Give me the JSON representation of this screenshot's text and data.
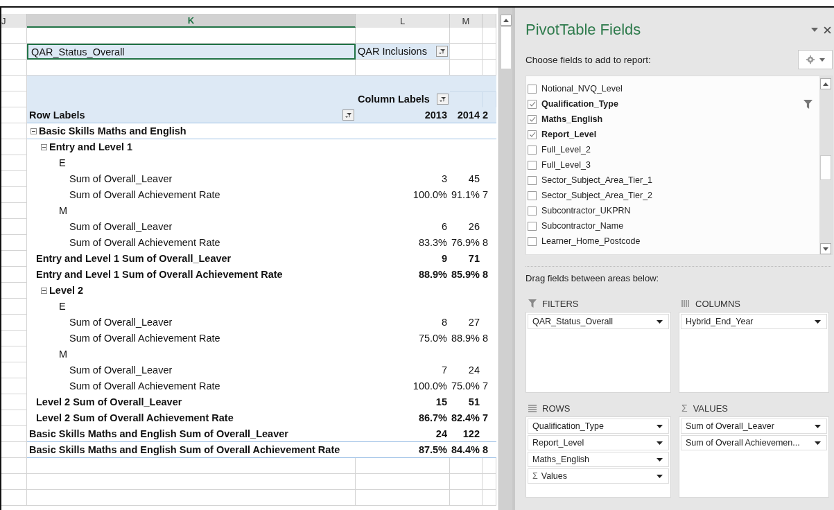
{
  "sheet": {
    "column_headers": [
      {
        "label": "J",
        "selected": false
      },
      {
        "label": "K",
        "selected": true
      },
      {
        "label": "L",
        "selected": false
      },
      {
        "label": "M",
        "selected": false
      }
    ],
    "report_filter": {
      "field": "QAR_Status_Overall",
      "value": "QAR Inclusions"
    },
    "pivot": {
      "column_labels": "Column Labels",
      "row_labels": "Row Labels",
      "years": [
        "2013",
        "2014",
        "2"
      ],
      "rows": [
        {
          "label": "Basic Skills Maths and English",
          "expanded": true,
          "children": [
            {
              "label": "Entry and Level 1",
              "expanded": true,
              "children": [
                {
                  "label": "E",
                  "children": [
                    {
                      "label": "Sum of Overall_Leaver",
                      "values": [
                        "3",
                        "45"
                      ]
                    },
                    {
                      "label": "Sum of Overall Achievement Rate",
                      "values": [
                        "100.0%",
                        "91.1%",
                        "7"
                      ]
                    }
                  ]
                },
                {
                  "label": "M",
                  "children": [
                    {
                      "label": "Sum of Overall_Leaver",
                      "values": [
                        "6",
                        "26"
                      ]
                    },
                    {
                      "label": "Sum of Overall Achievement Rate",
                      "values": [
                        "83.3%",
                        "76.9%",
                        "8"
                      ]
                    }
                  ]
                }
              ],
              "totals": [
                {
                  "label": "Entry and Level 1 Sum of Overall_Leaver",
                  "values": [
                    "9",
                    "71"
                  ]
                },
                {
                  "label": "Entry and Level 1 Sum of Overall Achievement Rate",
                  "values": [
                    "88.9%",
                    "85.9%",
                    "8"
                  ]
                }
              ]
            },
            {
              "label": "Level 2",
              "expanded": true,
              "children": [
                {
                  "label": "E",
                  "children": [
                    {
                      "label": "Sum of Overall_Leaver",
                      "values": [
                        "8",
                        "27"
                      ]
                    },
                    {
                      "label": "Sum of Overall Achievement Rate",
                      "values": [
                        "75.0%",
                        "88.9%",
                        "8"
                      ]
                    }
                  ]
                },
                {
                  "label": "M",
                  "children": [
                    {
                      "label": "Sum of Overall_Leaver",
                      "values": [
                        "7",
                        "24"
                      ]
                    },
                    {
                      "label": "Sum of Overall Achievement Rate",
                      "values": [
                        "100.0%",
                        "75.0%",
                        "7"
                      ]
                    }
                  ]
                }
              ],
              "totals": [
                {
                  "label": "Level 2 Sum of Overall_Leaver",
                  "values": [
                    "15",
                    "51"
                  ]
                },
                {
                  "label": "Level 2 Sum of Overall Achievement Rate",
                  "values": [
                    "86.7%",
                    "82.4%",
                    "7"
                  ]
                }
              ]
            }
          ],
          "totals": [
            {
              "label": "Basic Skills Maths and English Sum of Overall_Leaver",
              "values": [
                "24",
                "122"
              ]
            },
            {
              "label": "Basic Skills Maths and English Sum of Overall Achievement Rate",
              "values": [
                "87.5%",
                "84.4%",
                "8"
              ]
            }
          ]
        }
      ]
    }
  },
  "pane": {
    "title": "PivotTable Fields",
    "subtitle": "Choose fields to add to report:",
    "fields": [
      {
        "label": "Notional_NVQ_Level",
        "checked": false,
        "filtered": false
      },
      {
        "label": "Qualification_Type",
        "checked": true,
        "filtered": true
      },
      {
        "label": "Maths_English",
        "checked": true,
        "filtered": false
      },
      {
        "label": "Report_Level",
        "checked": true,
        "filtered": false
      },
      {
        "label": "Full_Level_2",
        "checked": false,
        "filtered": false
      },
      {
        "label": "Full_Level_3",
        "checked": false,
        "filtered": false
      },
      {
        "label": "Sector_Subject_Area_Tier_1",
        "checked": false,
        "filtered": false
      },
      {
        "label": "Sector_Subject_Area_Tier_2",
        "checked": false,
        "filtered": false
      },
      {
        "label": "Subcontractor_UKPRN",
        "checked": false,
        "filtered": false
      },
      {
        "label": "Subcontractor_Name",
        "checked": false,
        "filtered": false
      },
      {
        "label": "Learner_Home_Postcode",
        "checked": false,
        "filtered": false
      }
    ],
    "areas_hint": "Drag fields between areas below:",
    "areas": [
      {
        "kind": "filters",
        "title": "FILTERS",
        "items": [
          {
            "label": "QAR_Status_Overall"
          }
        ]
      },
      {
        "kind": "columns",
        "title": "COLUMNS",
        "items": [
          {
            "label": "Hybrid_End_Year"
          }
        ]
      },
      {
        "kind": "rows",
        "title": "ROWS",
        "items": [
          {
            "label": "Qualification_Type"
          },
          {
            "label": "Report_Level"
          },
          {
            "label": "Maths_English"
          },
          {
            "label": "Values",
            "symbol": "Σ"
          }
        ]
      },
      {
        "kind": "values",
        "title": "VALUES",
        "symbol": "Σ",
        "items": [
          {
            "label": "Sum of Overall_Leaver"
          },
          {
            "label": "Sum of Overall Achievemen..."
          }
        ]
      }
    ]
  }
}
